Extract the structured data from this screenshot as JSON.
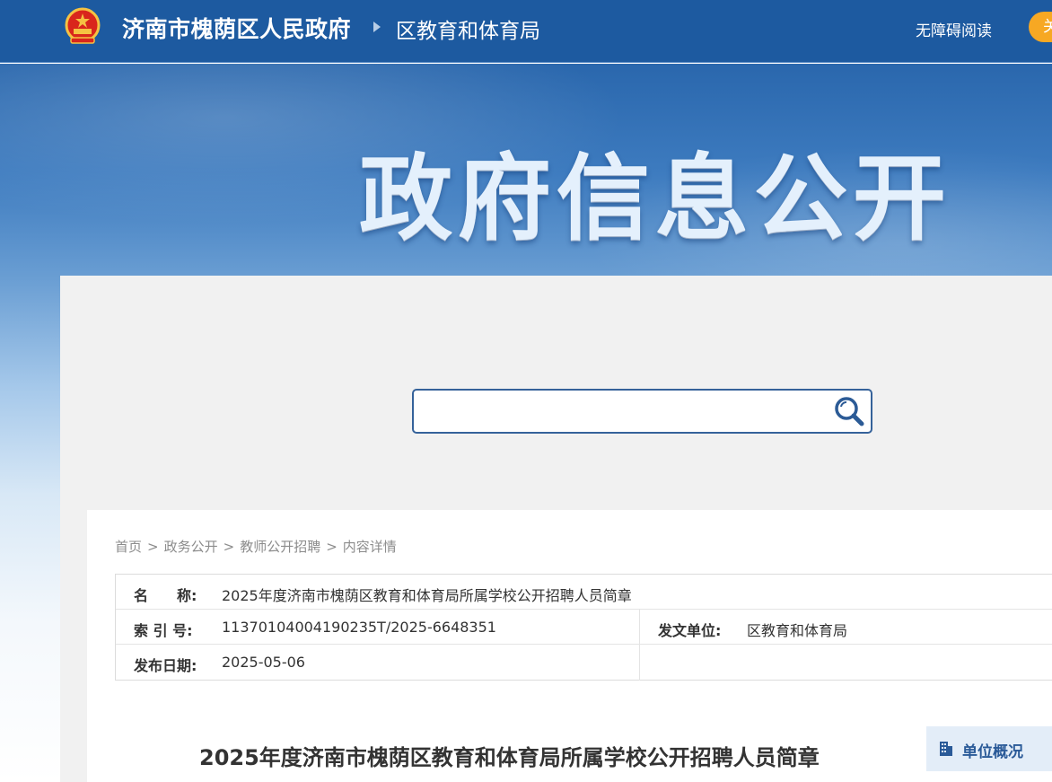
{
  "header": {
    "site_name": "济南市槐荫区人民政府",
    "dept_name": "区教育和体育局",
    "accessibility_link": "无障碍阅读",
    "care_button_label": "关"
  },
  "banner": {
    "title": "政府信息公开"
  },
  "search": {
    "placeholder": "",
    "value": ""
  },
  "breadcrumb": {
    "items": [
      "首页",
      "政务公开",
      "教师公开招聘",
      "内容详情"
    ],
    "separator": ">"
  },
  "meta": {
    "name_label": "名　　称:",
    "name_value": "2025年度济南市槐荫区教育和体育局所属学校公开招聘人员简章",
    "index_label": "索 引 号:",
    "index_value": "11370104004190235T/2025-6648351",
    "issuer_label": "发文单位:",
    "issuer_value": "区教育和体育局",
    "date_label": "发布日期:",
    "date_value": "2025-05-06"
  },
  "article": {
    "title": "2025年度济南市槐荫区教育和体育局所属学校公开招聘人员简章"
  },
  "sidebar": {
    "tab_label": "单位概况"
  },
  "colors": {
    "topbar": "#1d5aa0",
    "accent_orange": "#f7a823",
    "search_border": "#35629a",
    "side_tab_bg": "#e3edf8"
  },
  "icons": {
    "emblem": "national-emblem-icon",
    "search": "search-icon",
    "side_tab": "building-icon"
  }
}
